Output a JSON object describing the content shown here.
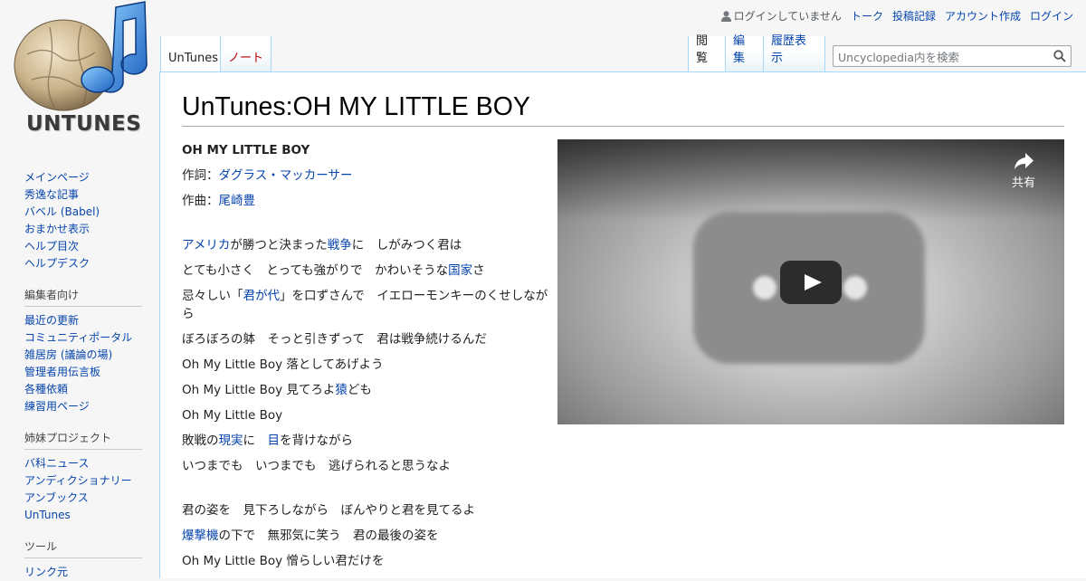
{
  "logo": {
    "text": "UNTUNES"
  },
  "personal": {
    "user_text": "ログインしていません",
    "links": [
      "トーク",
      "投稿記録",
      "アカウント作成",
      "ログイン"
    ]
  },
  "tabs": {
    "page": "UnTunes",
    "talk": "ノート",
    "view": "閲覧",
    "edit": "編集",
    "history": "履歴表示"
  },
  "search": {
    "placeholder": "Uncyclopedia内を検索"
  },
  "heading": "UnTunes:OH MY LITTLE BOY",
  "song": {
    "title": "OH MY LITTLE BOY",
    "lyricist_label": "作詞：",
    "lyricist": "ダグラス・マッカーサー",
    "composer_label": "作曲：",
    "composer": "尾崎豊"
  },
  "lyrics": {
    "l1_a": "アメリカ",
    "l1_b": "が勝つと決まった",
    "l1_c": "戦争",
    "l1_d": "に　しがみつく君は",
    "l2_a": "とても小さく　とっても強がりで　かわいそうな",
    "l2_b": "国家",
    "l2_c": "さ",
    "l3_a": "忌々しい「",
    "l3_b": "君が代",
    "l3_c": "」を口ずさんで　イエローモンキーのくせしながら",
    "l4": "ぼろぼろの躰　そっと引きずって　君は戦争続けるんだ",
    "l5": "Oh My Little Boy 落としてあげよう",
    "l6_a": "Oh My Little Boy 見てろよ",
    "l6_b": "猿",
    "l6_c": "ども",
    "l7": "Oh My Little Boy",
    "l8_a": "敗戦の",
    "l8_b": "現実",
    "l8_c": "に　",
    "l8_d": "目",
    "l8_e": "を背けながら",
    "l9": "いつまでも　いつまでも　逃げられると思うなよ",
    "l10": "君の姿を　見下ろしながら　ぼんやりと君を見てるよ",
    "l11_a": "爆撃機",
    "l11_b": "の下で　無邪気に笑う　君の最後の姿を",
    "l12": "Oh My Little Boy 憎らしい君だけを"
  },
  "video": {
    "share_label": "共有"
  },
  "sidebar": {
    "nav": [
      "メインページ",
      "秀逸な記事",
      "バベル (Babel)",
      "おまかせ表示",
      "ヘルプ目次",
      "ヘルプデスク"
    ],
    "editors_heading": "編集者向け",
    "editors": [
      "最近の更新",
      "コミュニティポータル",
      "雑居房 (議論の場)",
      "管理者用伝言板",
      "各種依頼",
      "練習用ページ"
    ],
    "sister_heading": "姉妹プロジェクト",
    "sister": [
      "バ科ニュース",
      "アンディクショナリー",
      "アンブックス",
      "UnTunes"
    ],
    "tools_heading": "ツール",
    "tools": [
      "リンク元"
    ]
  }
}
